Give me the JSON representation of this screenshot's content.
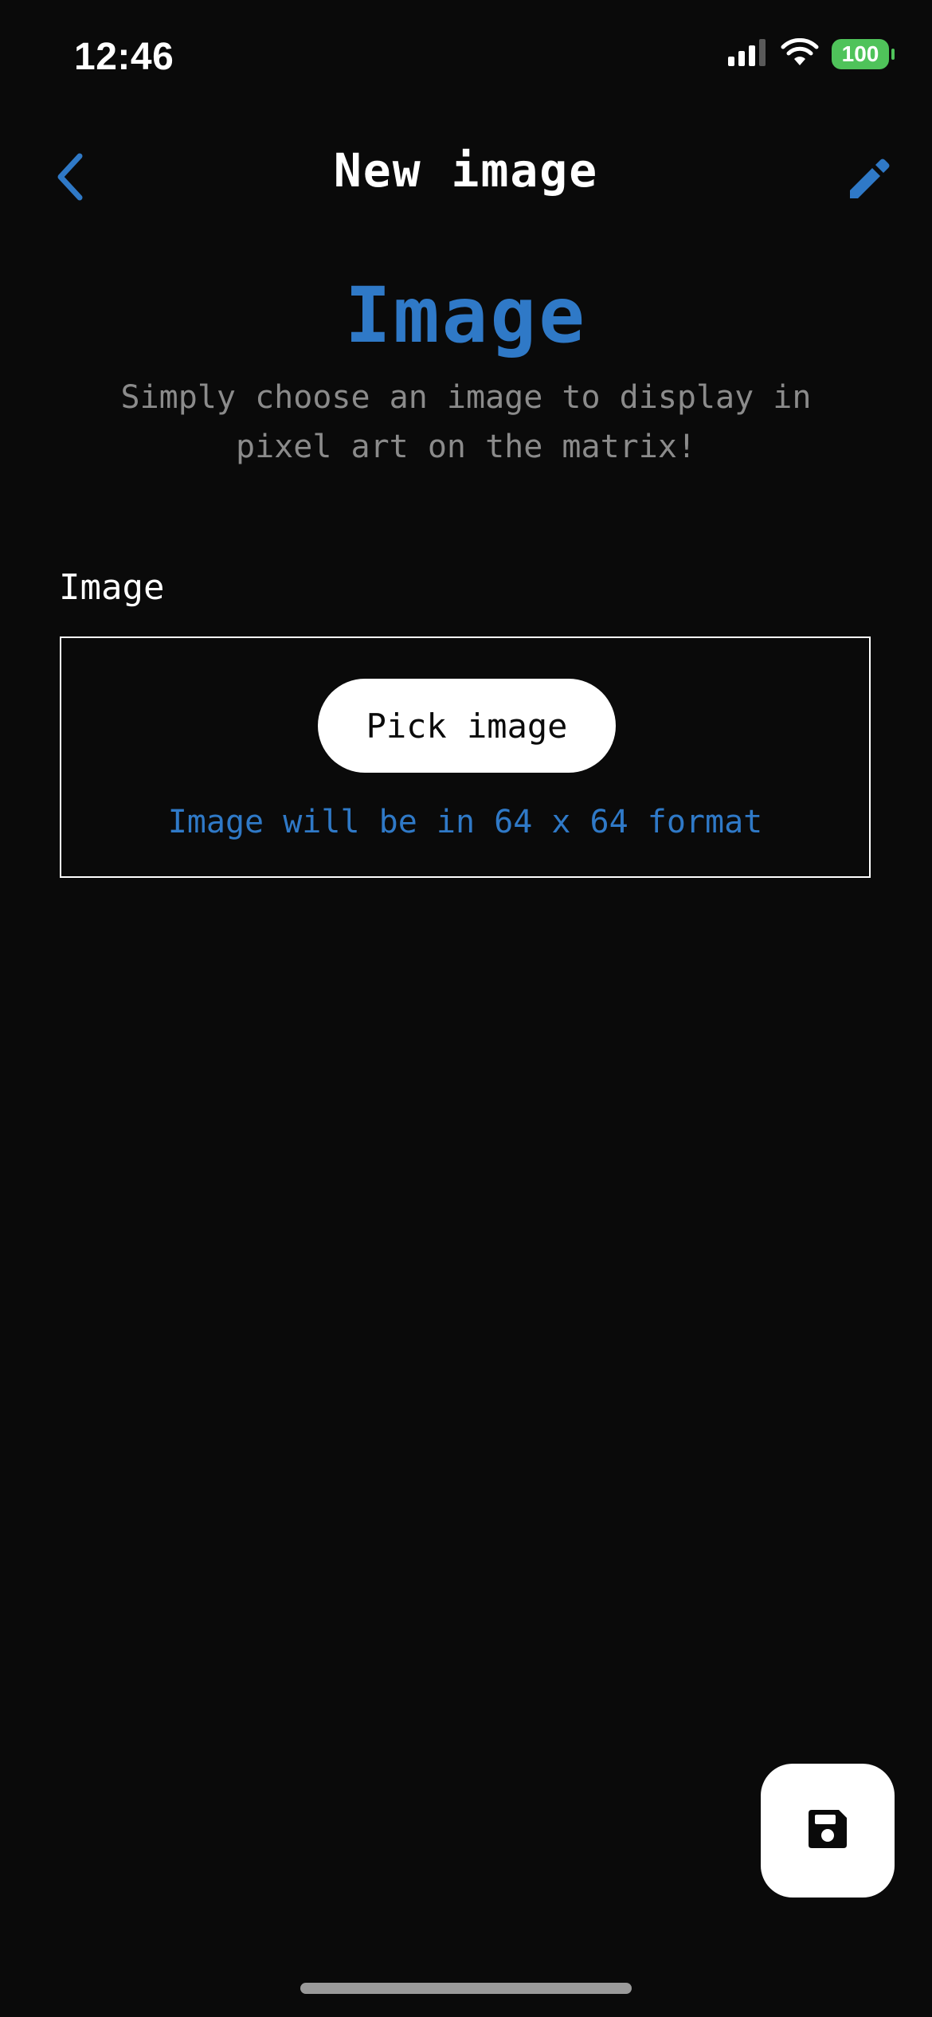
{
  "status_bar": {
    "time": "12:46",
    "battery": "100",
    "icons": [
      "cellular-signal-icon",
      "wifi-icon",
      "battery-icon"
    ]
  },
  "nav": {
    "title": "New image",
    "back_icon": "chevron-left-icon",
    "edit_icon": "pencil-icon"
  },
  "hero": {
    "title": "Image",
    "subtitle": "Simply choose an image to display in pixel art on the matrix!"
  },
  "form": {
    "section_label": "Image",
    "pick_button_label": "Pick image",
    "hint": "Image will be in 64 x 64 format"
  },
  "fab": {
    "icon": "save-icon"
  },
  "colors": {
    "background": "#0a0a0a",
    "accent": "#2f79c7",
    "muted_text": "#8b8b8b",
    "battery": "#4fc35a"
  }
}
